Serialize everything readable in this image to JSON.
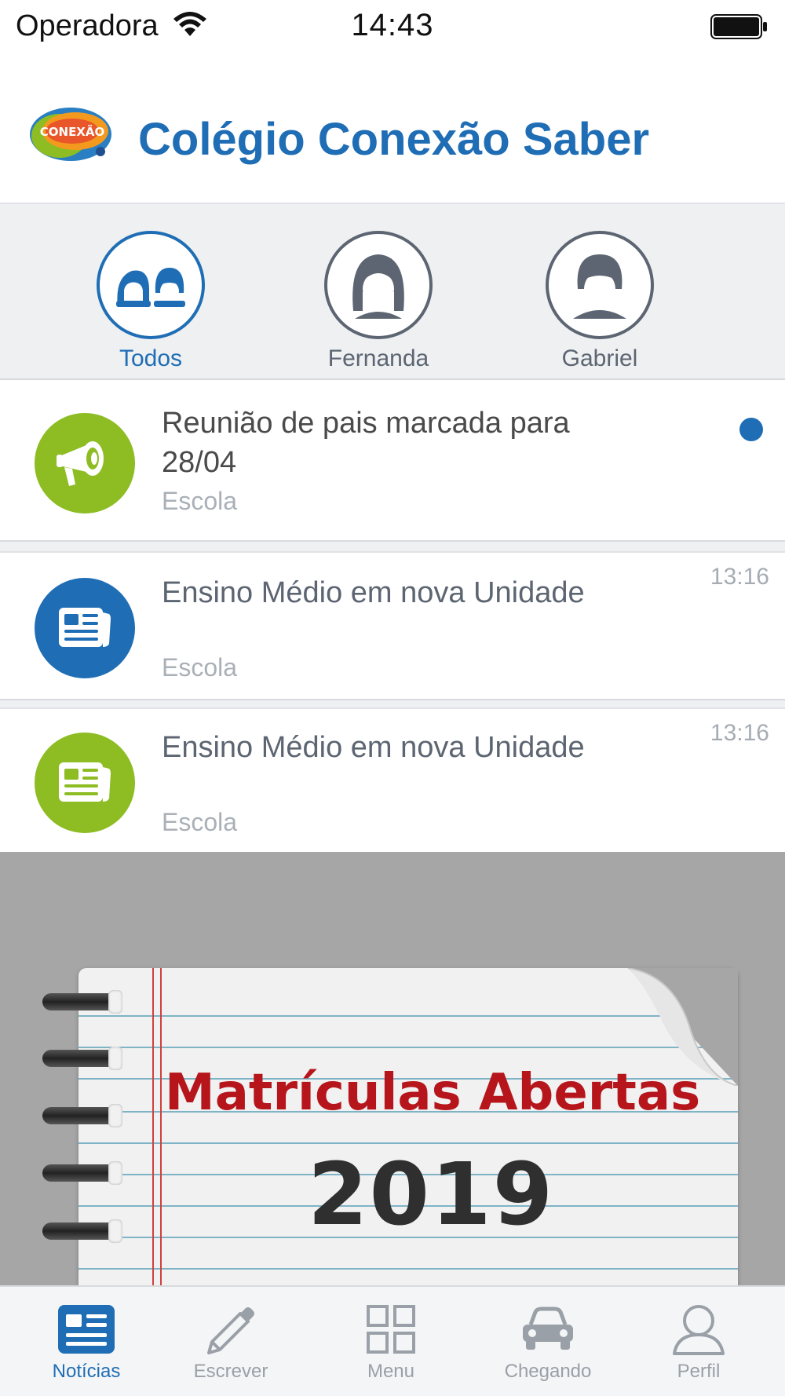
{
  "status_bar": {
    "carrier": "Operadora",
    "time": "14:43"
  },
  "header": {
    "logo_text": "CONEXÃO",
    "title": "Colégio Conexão Saber"
  },
  "filters": [
    {
      "label": "Todos",
      "active": true
    },
    {
      "label": "Fernanda",
      "active": false
    },
    {
      "label": "Gabriel",
      "active": false
    }
  ],
  "news": [
    {
      "title": "Reunião de pais marcada para 28/04",
      "source": "Escola",
      "time": "",
      "unread": true,
      "icon": "megaphone-icon",
      "color": "#8dbd22"
    },
    {
      "title": "Ensino Médio em nova Unidade",
      "source": "Escola",
      "time": "13:16",
      "unread": false,
      "icon": "newspaper-icon",
      "color": "#1f6eb5"
    },
    {
      "title": "Ensino Médio em nova Unidade",
      "source": "Escola",
      "time": "13:16",
      "unread": false,
      "icon": "newspaper-icon",
      "color": "#8dbd22"
    }
  ],
  "banner": {
    "title": "Matrículas Abertas",
    "year": "2019"
  },
  "tabs": [
    {
      "label": "Notícias",
      "active": true,
      "icon": "newspaper-icon"
    },
    {
      "label": "Escrever",
      "active": false,
      "icon": "pencil-icon"
    },
    {
      "label": "Menu",
      "active": false,
      "icon": "grid-icon"
    },
    {
      "label": "Chegando",
      "active": false,
      "icon": "car-icon"
    },
    {
      "label": "Perfil",
      "active": false,
      "icon": "person-icon"
    }
  ],
  "colors": {
    "brand_blue": "#1f6eb5",
    "brand_green": "#8dbd22",
    "banner_title_red": "#b5151b"
  }
}
